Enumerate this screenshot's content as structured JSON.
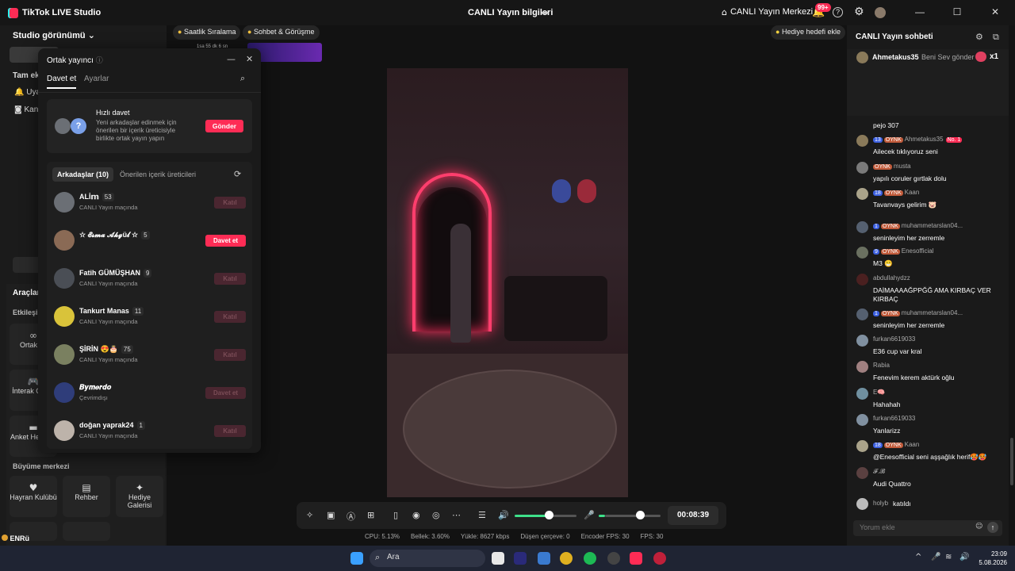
{
  "app": {
    "title": "TikTok LIVE Studio",
    "center_title": "CANLI Yayın bilgileri",
    "home_label": "CANLI Yayın Merkezi",
    "notif_badge": "99+"
  },
  "left": {
    "studio_view": "Studio görünümü",
    "partial_a": "Tam ekr",
    "partial_b": "Uya",
    "partial_c": "Kan",
    "tools_title": "Araçlar",
    "interaction_title": "Etkileşi",
    "tools": [
      {
        "label": "Ortak ya",
        "icon": "link-icon"
      },
      {
        "label": "İnterak Oyunl",
        "icon": "gamepad-icon"
      },
      {
        "label": "Anket Hediyey",
        "icon": "poll-icon"
      }
    ],
    "growth_title": "Büyüme merkezi",
    "growth": [
      {
        "label": "Hayran Kulübü",
        "icon": "heart-icon"
      },
      {
        "label": "Rehber",
        "icon": "book-icon"
      },
      {
        "label": "Hediye Galerisi",
        "icon": "gift-icon"
      }
    ],
    "bottom_user": "ENRü"
  },
  "chips": {
    "hourly": "Saatlik Sıralama",
    "chat_meet": "Sohbet & Görüşme",
    "gift_goal": "Hediye hedefi ekle",
    "timer_small": "1sa 55 dk 6 sn"
  },
  "modal": {
    "title": "Ortak yayıncı",
    "tab_invite": "Davet et",
    "tab_settings": "Ayarlar",
    "quick_title": "Hızlı davet",
    "quick_desc": "Yeni arkadaşlar edinmek için önerilen bir içerik üreticisiyle birlikte ortak yayın yapın",
    "send": "Gönder",
    "tab_friends": "Arkadaşlar (10)",
    "tab_suggested": "Önerilen içerik üreticileri",
    "friends": [
      {
        "name": "ALİ𝕞",
        "count": "53",
        "status": "CANLI Yayın maçında",
        "btn": "Katıl",
        "enabled": false,
        "color": "#6b6f75"
      },
      {
        "name": "☆ 𝓔𝓼𝓶𝓪 𝓐𝓴𝓰ü𝓵 ☆",
        "count": "5",
        "status": "",
        "btn": "Davet et",
        "enabled": true,
        "color": "#8a6a55"
      },
      {
        "name": "Fatih GÜMÜŞHAN",
        "count": "9",
        "status": "CANLI Yayın maçında",
        "btn": "Katıl",
        "enabled": false,
        "color": "#4a4e55"
      },
      {
        "name": "Tankurt Manas",
        "count": "11",
        "status": "CANLI Yayın maçında",
        "btn": "Katıl",
        "enabled": false,
        "color": "#d9c33a"
      },
      {
        "name": "ŞİRİN 😍🎂",
        "count": "75",
        "status": "CANLI Yayın maçında",
        "btn": "Katıl",
        "enabled": false,
        "color": "#7a8060"
      },
      {
        "name": "𝑩𝒚𝒎𝒆𝒓𝒅𝒐",
        "count": "",
        "status": "Çevrimdışı",
        "btn": "Davet et",
        "enabled": false,
        "color": "#2f3d7a"
      },
      {
        "name": "doğan yaprak24",
        "count": "1",
        "status": "CANLI Yayın maçında",
        "btn": "Katıl",
        "enabled": false,
        "color": "#bdb3aa"
      }
    ]
  },
  "controls": {
    "timer": "00:08:39"
  },
  "stats": {
    "cpu": "CPU: 5.13%",
    "mem": "Bellek: 3.60%",
    "upload": "Yükle: 8627 kbps",
    "dropped": "Düşen çerçeve: 0",
    "enc": "Encoder FPS: 30",
    "fps": "FPS: 30"
  },
  "chat": {
    "title": "CANLI Yayın sohbeti",
    "pinned_user": "Ahmetakus35",
    "pinned_text": "Beni Sev gönder",
    "pinned_mult": "x1",
    "messages": [
      {
        "user": "",
        "text": "pejo 307",
        "lvl": "",
        "fan": "",
        "extra": "",
        "color": "#6a6a6a"
      },
      {
        "user": "Ahmetakus35",
        "text": "Ailecek tıklıyoruz seni",
        "lvl": "13",
        "fan": "OYNK",
        "extra": "No. 1",
        "color": "#8a7a5a"
      },
      {
        "user": "musta",
        "text": "yapılı coruler gırtlak dolu",
        "lvl": "",
        "fan": "OYNK",
        "extra": "",
        "color": "#7a7a7a"
      },
      {
        "user": "Kaan",
        "text": "Tavanvays gelirim 🐷",
        "lvl": "18",
        "fan": "OYNK",
        "extra": "",
        "color": "#aaa38a"
      },
      {
        "user": "muhammetarslan04...",
        "text": "seninleyim her zerremle",
        "lvl": "1",
        "fan": "OYNK",
        "extra": "",
        "color": "#556070"
      },
      {
        "user": "Enesofficial",
        "text": "M3 😁",
        "lvl": "9",
        "fan": "OYNK",
        "extra": "",
        "color": "#6a7060"
      },
      {
        "user": "abdullahydzz",
        "text": "DAİMAAAAĞPPĞĞ AMA KIRBAÇ VER KIRBAÇ",
        "lvl": "",
        "fan": "",
        "extra": "",
        "color": "#4a2020"
      },
      {
        "user": "muhammetarslan04...",
        "text": "seninleyim her zerremle",
        "lvl": "1",
        "fan": "OYNK",
        "extra": "",
        "color": "#556070"
      },
      {
        "user": "furkan6619033",
        "text": "E36 cup var kral",
        "lvl": "",
        "fan": "",
        "extra": "",
        "color": "#8090a0"
      },
      {
        "user": "Rabia",
        "text": "Fenevim kerem aktürk oğlu",
        "lvl": "",
        "fan": "",
        "extra": "",
        "color": "#a08080"
      },
      {
        "user": "E🧠",
        "text": "Hahahah",
        "lvl": "",
        "fan": "",
        "extra": "",
        "color": "#7090a0"
      },
      {
        "user": "furkan6619033",
        "text": "Yanlarizz",
        "lvl": "",
        "fan": "",
        "extra": "",
        "color": "#8090a0"
      },
      {
        "user": "Kaan",
        "text": "@Enesofficial seni aşşağlık herif🥵🥵",
        "lvl": "18",
        "fan": "OYNK",
        "extra": "",
        "color": "#aaa38a"
      },
      {
        "user": "𝓕.𝓑",
        "text": "Audi Quattro",
        "lvl": "",
        "fan": "",
        "extra": "",
        "color": "#5a4040"
      }
    ],
    "joined_user": "holyb",
    "joined_text": "katıldı",
    "placeholder": "Yorum ekle"
  },
  "taskbar": {
    "search": "Ara",
    "time": "23:09",
    "date": "5.08.2026"
  }
}
